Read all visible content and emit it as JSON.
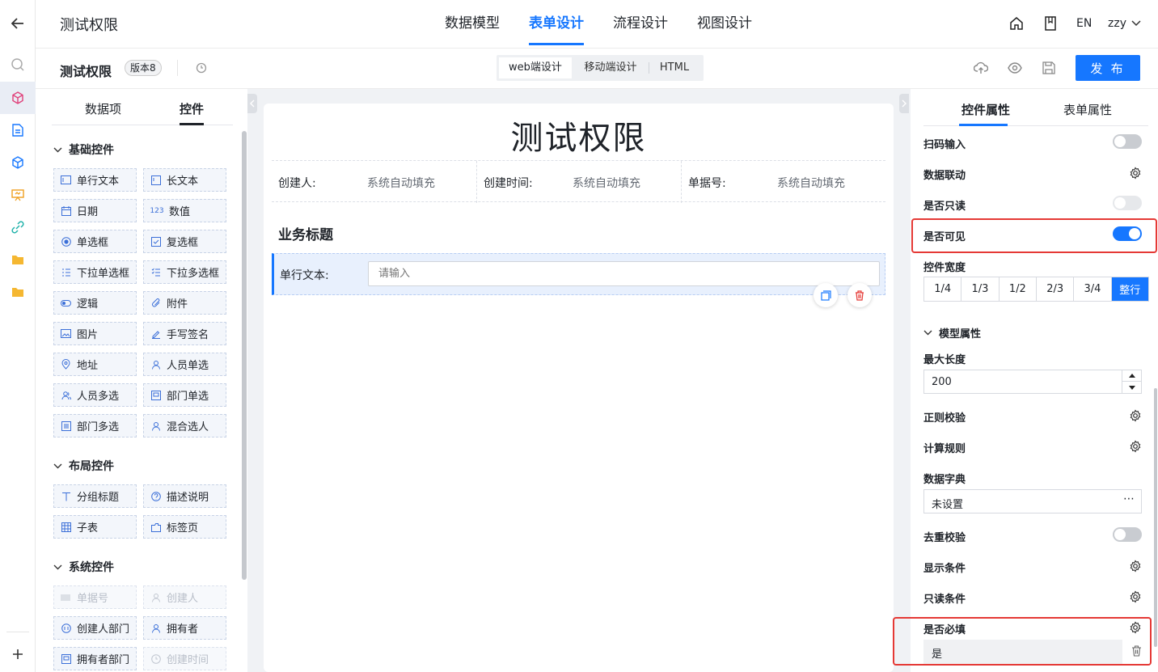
{
  "header": {
    "app_title": "测试权限",
    "tabs": [
      {
        "label": "数据模型"
      },
      {
        "label": "表单设计"
      },
      {
        "label": "流程设计"
      },
      {
        "label": "视图设计"
      }
    ],
    "active_tab": "表单设计",
    "lang": "EN",
    "user": "zzy"
  },
  "toolbar": {
    "form_name": "测试权限",
    "version_badge": "版本8",
    "modes": [
      "web端设计",
      "移动端设计",
      "HTML"
    ],
    "active_mode": "web端设计",
    "publish_label": "发 布"
  },
  "palette": {
    "tabs": [
      "数据项",
      "控件"
    ],
    "active_tab": "控件",
    "sections": [
      {
        "title": "基础控件",
        "items": [
          "单行文本",
          "长文本",
          "日期",
          "数值",
          "单选框",
          "复选框",
          "下拉单选框",
          "下拉多选框",
          "逻辑",
          "附件",
          "图片",
          "手写签名",
          "地址",
          "人员单选",
          "人员多选",
          "部门单选",
          "部门多选",
          "混合选人"
        ]
      },
      {
        "title": "布局控件",
        "items": [
          "分组标题",
          "描述说明",
          "子表",
          "标签页"
        ]
      },
      {
        "title": "系统控件",
        "items": [
          "单据号",
          "创建人",
          "创建人部门",
          "拥有者",
          "拥有者部门",
          "创建时间"
        ]
      }
    ]
  },
  "canvas": {
    "form_title": "测试权限",
    "sys_fields": [
      {
        "label": "创建人:",
        "value": "系统自动填充"
      },
      {
        "label": "创建时间:",
        "value": "系统自动填充"
      },
      {
        "label": "单据号:",
        "value": "系统自动填充"
      }
    ],
    "section_title": "业务标题",
    "field_label": "单行文本:",
    "field_placeholder": "请输入"
  },
  "props": {
    "tabs": [
      "控件属性",
      "表单属性"
    ],
    "active_tab": "控件属性",
    "scan_input": "扫码输入",
    "data_linkage": "数据联动",
    "readonly": "是否只读",
    "visible": "是否可见",
    "width_label": "控件宽度",
    "widths": [
      "1/4",
      "1/3",
      "1/2",
      "2/3",
      "3/4",
      "整行"
    ],
    "active_width": "整行",
    "model_section": "模型属性",
    "max_length_label": "最大长度",
    "max_length_value": "200",
    "regex": "正则校验",
    "calc_rule": "计算规则",
    "dict_label": "数据字典",
    "dict_value": "未设置",
    "dedupe": "去重校验",
    "show_cond": "显示条件",
    "readonly_cond": "只读条件",
    "required_label": "是否必填",
    "required_value": "是"
  },
  "colors": {
    "accent": "#1677ff",
    "highlight": "#e53935"
  }
}
